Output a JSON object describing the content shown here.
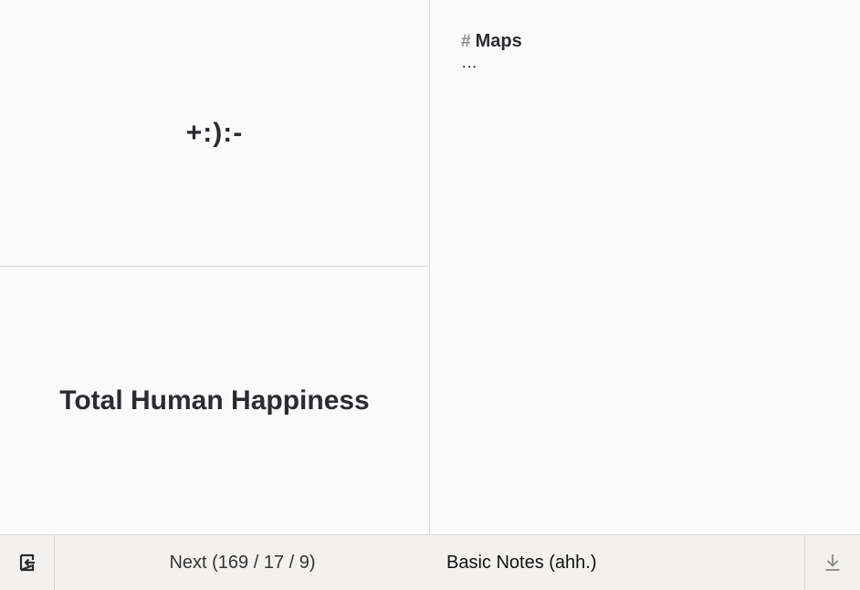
{
  "card": {
    "front_text": "+:):-",
    "back_text": "Total Human Happiness"
  },
  "deck": {
    "hash_symbol": "#",
    "title": "Maps",
    "ellipsis": "…"
  },
  "bottom_bar": {
    "exit_icon": "exit-icon",
    "next_label": "Next (169 / 17 / 9)",
    "deck_label": "Basic Notes (ahh.)",
    "download_icon": "download-icon"
  },
  "colors": {
    "background": "#fafafa",
    "bar_background": "#f2f1ef",
    "text": "#2a2c30",
    "muted": "#8a8a8a",
    "divider": "#dcdcdc"
  }
}
